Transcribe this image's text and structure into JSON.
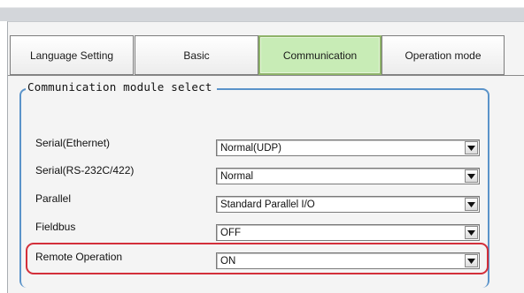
{
  "tabs": [
    {
      "label": "Language Setting",
      "active": false
    },
    {
      "label": "Basic",
      "active": false
    },
    {
      "label": "Communication",
      "active": true
    },
    {
      "label": "Operation mode",
      "active": false
    }
  ],
  "group": {
    "title": "Communication module select"
  },
  "rows": [
    {
      "label": "Serial(Ethernet)",
      "value": "Normal(UDP)"
    },
    {
      "label": "Serial(RS-232C/422)",
      "value": "Normal"
    },
    {
      "label": "Parallel",
      "value": "Standard Parallel I/O"
    },
    {
      "label": "Fieldbus",
      "value": "OFF"
    },
    {
      "label": "Remote Operation",
      "value": "ON"
    }
  ],
  "icons": {
    "dropdown_arrow": "chevron-down-icon"
  },
  "colors": {
    "active_tab": "#c8ecb6",
    "group_border": "#5a93c9",
    "highlight": "#d32f3a"
  }
}
